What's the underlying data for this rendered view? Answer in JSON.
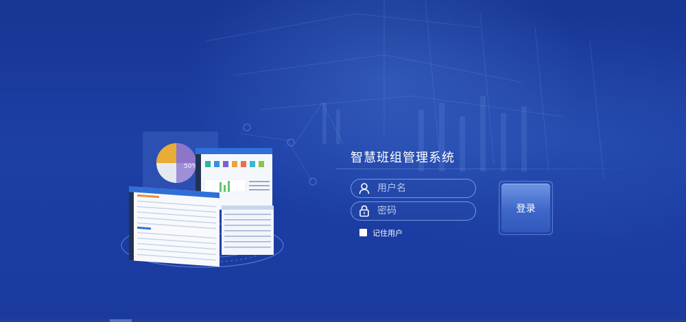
{
  "app": {
    "title": "智慧班组管理系统"
  },
  "login": {
    "username_placeholder": "用户名",
    "password_placeholder": "密码",
    "remember_label": "记住用户",
    "remember_checked": false,
    "submit_label": "登录"
  },
  "icons": {
    "username": "user-icon",
    "password": "lock-icon"
  },
  "illustration": {
    "pie_chart_label": "50%",
    "module_colors": [
      "#2bb3a3",
      "#3a8de0",
      "#7a5fd6",
      "#e9a53a",
      "#e96f4b",
      "#3ab7d4",
      "#8bc34a"
    ]
  },
  "colors": {
    "background": "#1b3a9f",
    "login_button": "#3e67c8",
    "field_border": "#96b4f5"
  }
}
